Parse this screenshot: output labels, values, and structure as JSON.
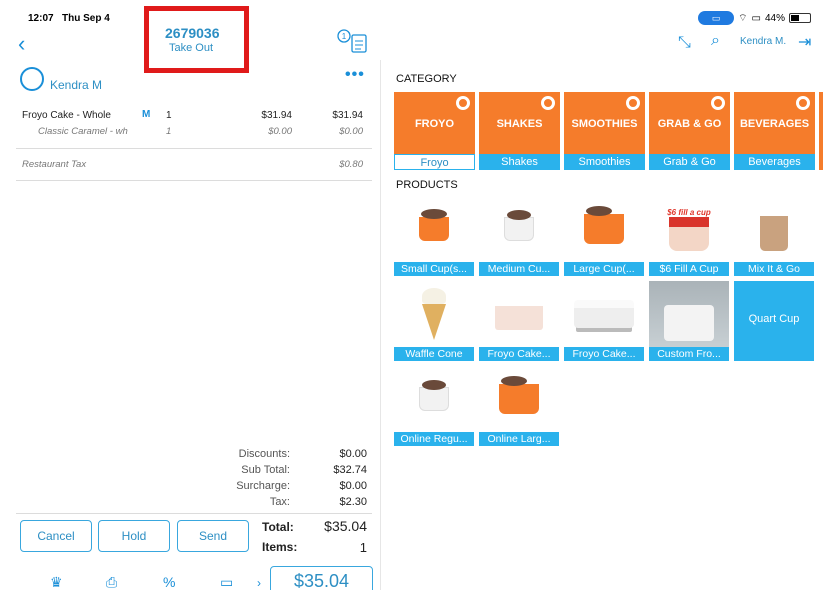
{
  "status_bar": {
    "time": "12:07",
    "date": "Thu Sep 4",
    "battery": "44%"
  },
  "order": {
    "number": "2679036",
    "type": "Take Out",
    "receipt_badge": "1"
  },
  "customer": {
    "name": "Kendra M"
  },
  "items": [
    {
      "name": "Froyo Cake - Whole",
      "marker": "M",
      "qty": "1",
      "price": "$31.94",
      "total": "$31.94"
    },
    {
      "name": "Classic Caramel - wh",
      "marker": "",
      "qty": "1",
      "price": "$0.00",
      "total": "$0.00"
    }
  ],
  "tax_line": {
    "name": "Restaurant Tax",
    "total": "$0.80"
  },
  "totals": {
    "discounts_label": "Discounts:",
    "discounts": "$0.00",
    "subtotal_label": "Sub Total:",
    "subtotal": "$32.74",
    "surcharge_label": "Surcharge:",
    "surcharge": "$0.00",
    "tax_label": "Tax:",
    "tax": "$2.30",
    "total_label": "Total:",
    "total": "$35.04",
    "items_label": "Items:",
    "items": "1"
  },
  "actions": {
    "cancel": "Cancel",
    "hold": "Hold",
    "send": "Send",
    "pay": "$35.04"
  },
  "right_header": {
    "user": "Kendra M."
  },
  "category_label": "CATEGORY",
  "products_label": "PRODUCTS",
  "categories": [
    {
      "word": "FROYO",
      "label": "Froyo",
      "selected": true
    },
    {
      "word": "SHAKES",
      "label": "Shakes"
    },
    {
      "word": "SMOOTHIES",
      "label": "Smoothies"
    },
    {
      "word": "GRAB & GO",
      "label": "Grab & Go"
    },
    {
      "word": "BEVERAGES",
      "label": "Beverages"
    }
  ],
  "products": [
    {
      "label": "Small Cup(s...",
      "image": "small-cup"
    },
    {
      "label": "Medium Cu...",
      "image": "medium-cup"
    },
    {
      "label": "Large Cup(...",
      "image": "large-cup"
    },
    {
      "label": "$6 Fill A Cup",
      "image": "fill-a-cup",
      "banner": "$6 fill a cup"
    },
    {
      "label": "Mix It & Go",
      "image": "mix-it-go"
    },
    {
      "label": "Waffle Cone",
      "image": "waffle-cone"
    },
    {
      "label": "Froyo Cake...",
      "image": "froyo-cake-slice"
    },
    {
      "label": "Froyo Cake...",
      "image": "froyo-cake-whole"
    },
    {
      "label": "Custom Fro...",
      "image": "custom-cake"
    },
    {
      "label": "Quart Cup",
      "image": "none"
    },
    {
      "label": "Online Regu...",
      "image": "online-regular"
    },
    {
      "label": "Online Larg...",
      "image": "online-large"
    }
  ],
  "colors": {
    "accent": "#2ab2ec",
    "brand_orange": "#f57c2b",
    "highlight": "#e01a1a"
  }
}
